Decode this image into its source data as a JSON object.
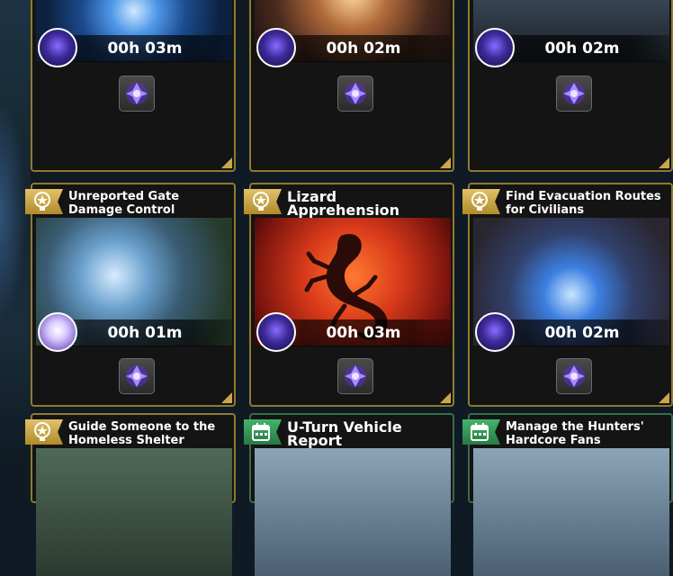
{
  "cards": [
    {
      "id": "top-1",
      "timer": "00h 03m"
    },
    {
      "id": "top-2",
      "timer": "00h 02m"
    },
    {
      "id": "top-3",
      "timer": "00h 02m"
    },
    {
      "id": "mid-1",
      "title": "Unreported Gate Damage Control",
      "timer": "00h 01m"
    },
    {
      "id": "mid-2",
      "title": "Lizard Apprehension",
      "timer": "00h 03m"
    },
    {
      "id": "mid-3",
      "title": "Find Evacuation Routes for Civilians",
      "timer": "00h 02m"
    },
    {
      "id": "bot-1",
      "title": "Guide Someone to the Homeless Shelter"
    },
    {
      "id": "bot-2",
      "title": "U-Turn Vehicle Report"
    },
    {
      "id": "bot-3",
      "title": "Manage the Hunters' Hardcore Fans"
    }
  ],
  "colors": {
    "gold_border": "#8f7b2c",
    "green_badge": "#2f9a55",
    "gold_badge": "#c9a84a",
    "reward_purple": "#7a4dff"
  },
  "icons": {
    "gold_badge": "medal-icon",
    "green_badge": "calendar-icon",
    "reward": "magic-crystal-icon"
  }
}
